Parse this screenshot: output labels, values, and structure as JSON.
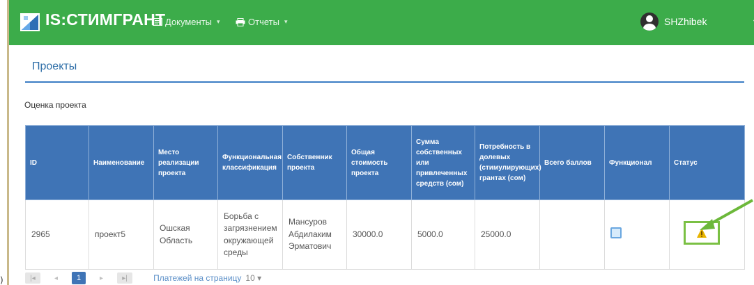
{
  "header": {
    "brand": "IS:СТИМГРАНТ",
    "nav": [
      {
        "label": "Документы",
        "icon": "document-icon"
      },
      {
        "label": "Отчеты",
        "icon": "print-icon"
      }
    ],
    "user": "SHZhibek",
    "accent": "#3cac4a"
  },
  "page": {
    "title": "Проекты",
    "section": "Оценка проекта"
  },
  "table": {
    "headers": [
      "ID",
      "Наименование",
      "Место реализации проекта",
      "Функциональная классификация",
      "Собственник проекта",
      "Общая стоимость проекта",
      "Сумма собственных или привлеченных средств (сом)",
      "Потребность в долевых (стимулирующих) грантах (сом)",
      "Всего баллов",
      "Функционал",
      "Статус"
    ],
    "rows": [
      {
        "id": "2965",
        "name": "проект5",
        "place": "Ошская Область",
        "classification": "Борьба с загрязнением окружающей среды",
        "owner": "Мансуров Абдилаким Эрматович",
        "total": "30000.0",
        "own_funds": "5000.0",
        "grant_need": "25000.0",
        "score": "",
        "action_icon": "edit-icon",
        "status_icon": "warning-icon"
      }
    ],
    "header_color": "#3f74b6"
  },
  "pager": {
    "current": "1",
    "per_page_label": "Платежей на страницу",
    "per_page_value": "10 ▾"
  },
  "left_fragment": ")"
}
